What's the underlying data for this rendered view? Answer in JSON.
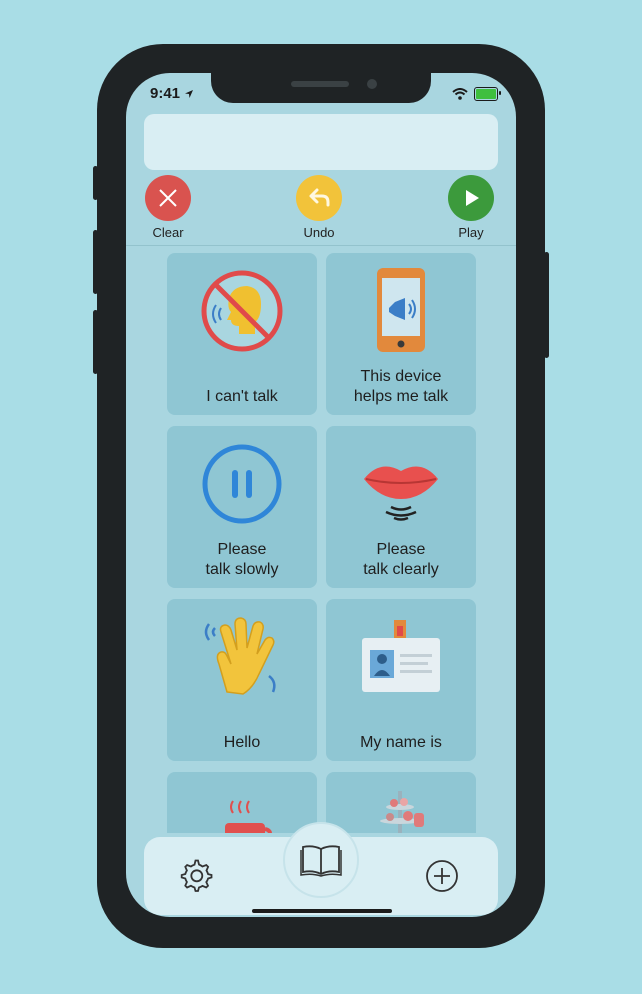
{
  "status": {
    "time": "9:41"
  },
  "toolbar": {
    "clear_label": "Clear",
    "undo_label": "Undo",
    "play_label": "Play",
    "colors": {
      "clear": "#d9534f",
      "undo": "#f2c33a",
      "play": "#3c9a3c"
    }
  },
  "phrases": [
    {
      "label": "I can't talk",
      "icon": "no-talking-icon"
    },
    {
      "label": "This device\nhelps me talk",
      "icon": "phone-speaker-icon"
    },
    {
      "label": "Please\ntalk slowly",
      "icon": "pause-icon"
    },
    {
      "label": "Please\ntalk clearly",
      "icon": "lips-icon"
    },
    {
      "label": "Hello",
      "icon": "waving-hand-icon"
    },
    {
      "label": "My name is",
      "icon": "id-badge-icon"
    },
    {
      "label": "",
      "icon": "coffee-cup-icon"
    },
    {
      "label": "",
      "icon": "food-icon"
    }
  ],
  "bottom_bar": {
    "settings_icon": "gear-icon",
    "library_icon": "book-icon",
    "add_icon": "plus-circle-icon"
  }
}
